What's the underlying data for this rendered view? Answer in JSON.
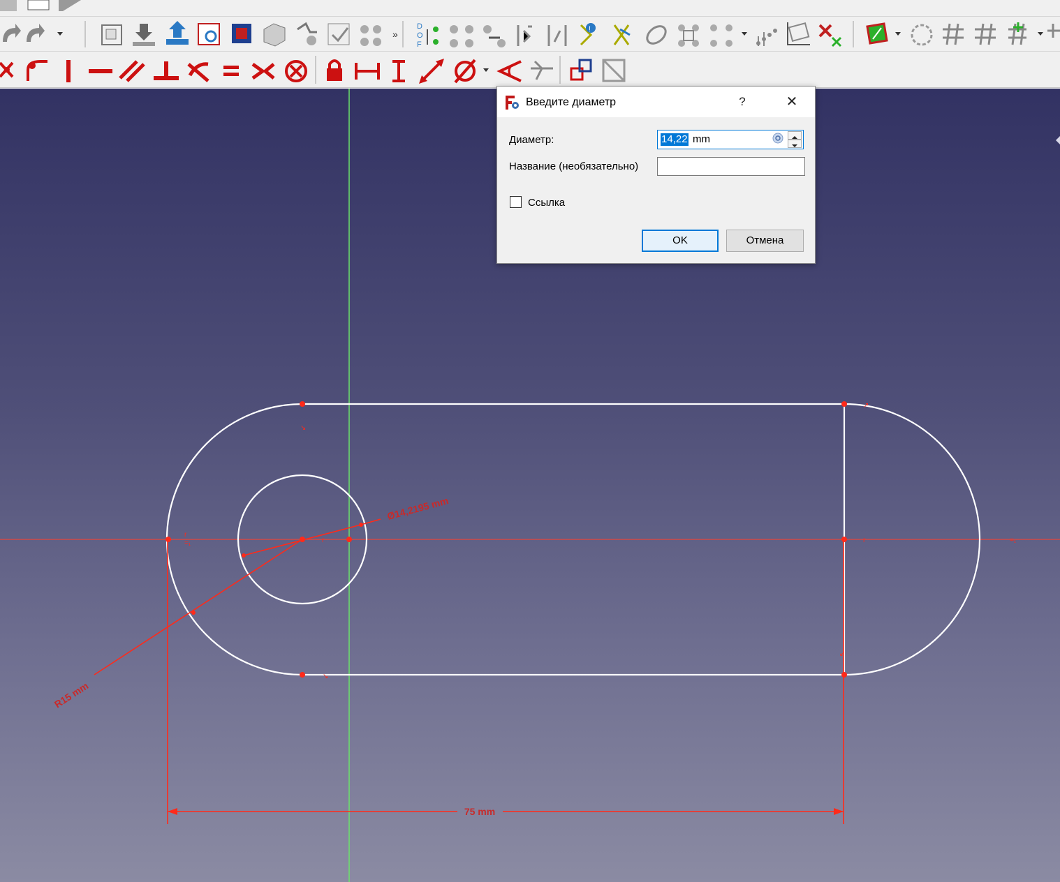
{
  "dialog": {
    "title": "Введите диаметр",
    "help": "?",
    "close": "✕",
    "diameter_label": "Диаметр:",
    "diameter_value": "14,22",
    "diameter_unit": "mm",
    "name_label": "Название (необязательно)",
    "name_value": "",
    "reference_label": "Ссылка",
    "reference_checked": false,
    "ok_label": "OK",
    "cancel_label": "Отмена"
  },
  "sketch": {
    "dim_diameter": "Ø14,2195 mm",
    "dim_radius": "R15 mm",
    "dim_length": "75 mm"
  },
  "colors": {
    "constraint_red": "#ff2a1a",
    "geometry_white": "#ffffff",
    "v_axis": "#6be36b",
    "accent_blue": "#0078d7"
  },
  "toolbar_overflow": "»"
}
